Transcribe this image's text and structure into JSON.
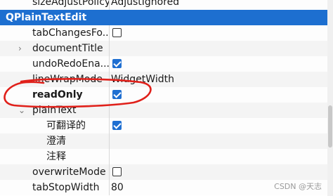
{
  "rows": [
    {
      "name": "sizeAdjustPolicy",
      "value": "AdjustIgnored",
      "kind": "text"
    },
    {
      "name": "QPlainTextEdit",
      "kind": "section"
    },
    {
      "name": "tabChangesFo...",
      "kind": "checkbox",
      "checked": false
    },
    {
      "name": "documentTitle",
      "kind": "expandable"
    },
    {
      "name": "undoRedoEna...",
      "kind": "checkbox",
      "checked": true
    },
    {
      "name": "lineWrapMode",
      "value": "WidgetWidth",
      "kind": "text"
    },
    {
      "name": "readOnly",
      "kind": "checkbox",
      "checked": true,
      "bold": true
    },
    {
      "name": "plainText",
      "kind": "expanded"
    },
    {
      "name": "可翻译的",
      "kind": "checkbox",
      "checked": true,
      "indent": true
    },
    {
      "name": "澄清",
      "kind": "empty",
      "indent": true
    },
    {
      "name": "注释",
      "kind": "empty",
      "indent": true
    },
    {
      "name": "overwriteMode",
      "kind": "checkbox",
      "checked": false
    },
    {
      "name": "tabStopWidth",
      "value": "80",
      "kind": "text"
    }
  ],
  "annotation_color": "#e0201a",
  "watermark": "CSDN @天志"
}
